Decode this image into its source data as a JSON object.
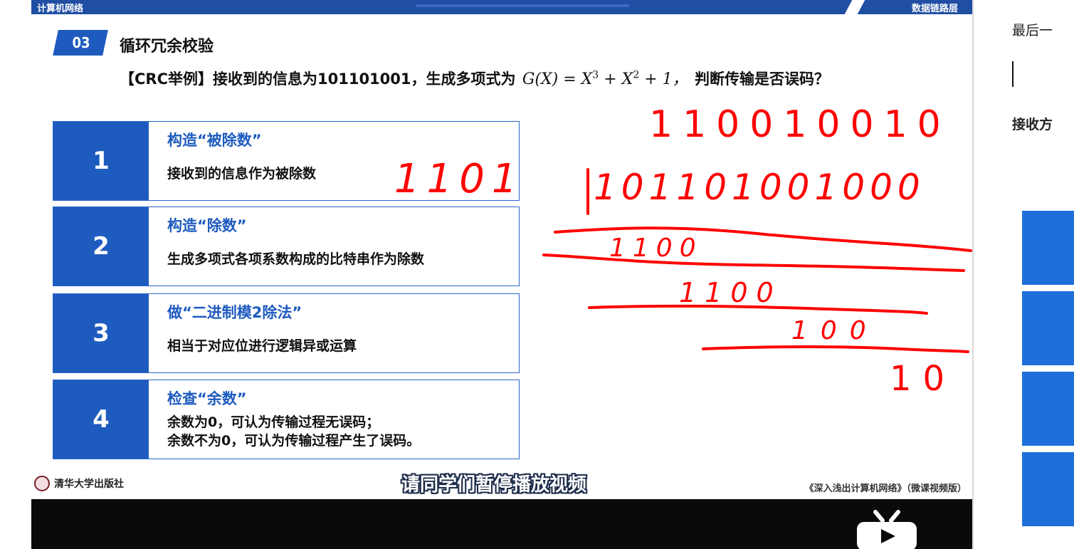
{
  "slide": {
    "top_bar_crumb": "计算机网络",
    "top_bar_topic": "数据链路层",
    "section_number": "03",
    "section_title": "循环冗余校验",
    "question": {
      "prefix": "【CRC举例】接收到的信息为101101001，生成多项式为",
      "formula_g": "G(X) = X",
      "exp1": "3",
      "formula_mid": " + X",
      "exp2": "2",
      "formula_end": " + 1，",
      "suffix": "判断传输是否误码？"
    },
    "steps": [
      {
        "number": "1",
        "title": "构造“被除数”",
        "desc": "接收到的信息作为被除数"
      },
      {
        "number": "2",
        "title": "构造“除数”",
        "desc": "生成多项式各项系数构成的比特串作为除数"
      },
      {
        "number": "3",
        "title": "做“二进制模2除法”",
        "desc": "相当于对应位进行逻辑异或运算"
      },
      {
        "number": "4",
        "title": "检查“余数”",
        "desc_line1": "余数为0，可认为传输过程无误码；",
        "desc_line2": "余数不为0，可认为传输过程产生了误码。"
      }
    ],
    "publisher": "清华大学出版社",
    "subtitle": "请同学们暂停播放视频",
    "book_title": "《深入浅出计算机网络》（微课视频版）",
    "handwriting": {
      "divisor": "1101",
      "quotient": "110010010",
      "dividend": "101101001000",
      "partial_1": "1100",
      "partial_2": "1100",
      "partial_3": "100",
      "remainder": "10",
      "ink_color": "#ff0000"
    }
  },
  "side_panel": {
    "heading": "最后一",
    "subheading": "接收方"
  },
  "colors": {
    "accent_blue": "#1e5bbf",
    "top_bar": "#1f4ea3",
    "side_block": "#1e6fd9",
    "player_bar": "#0a0a0a"
  },
  "icons": [
    "tv-logo-icon",
    "publisher-seal-icon"
  ]
}
